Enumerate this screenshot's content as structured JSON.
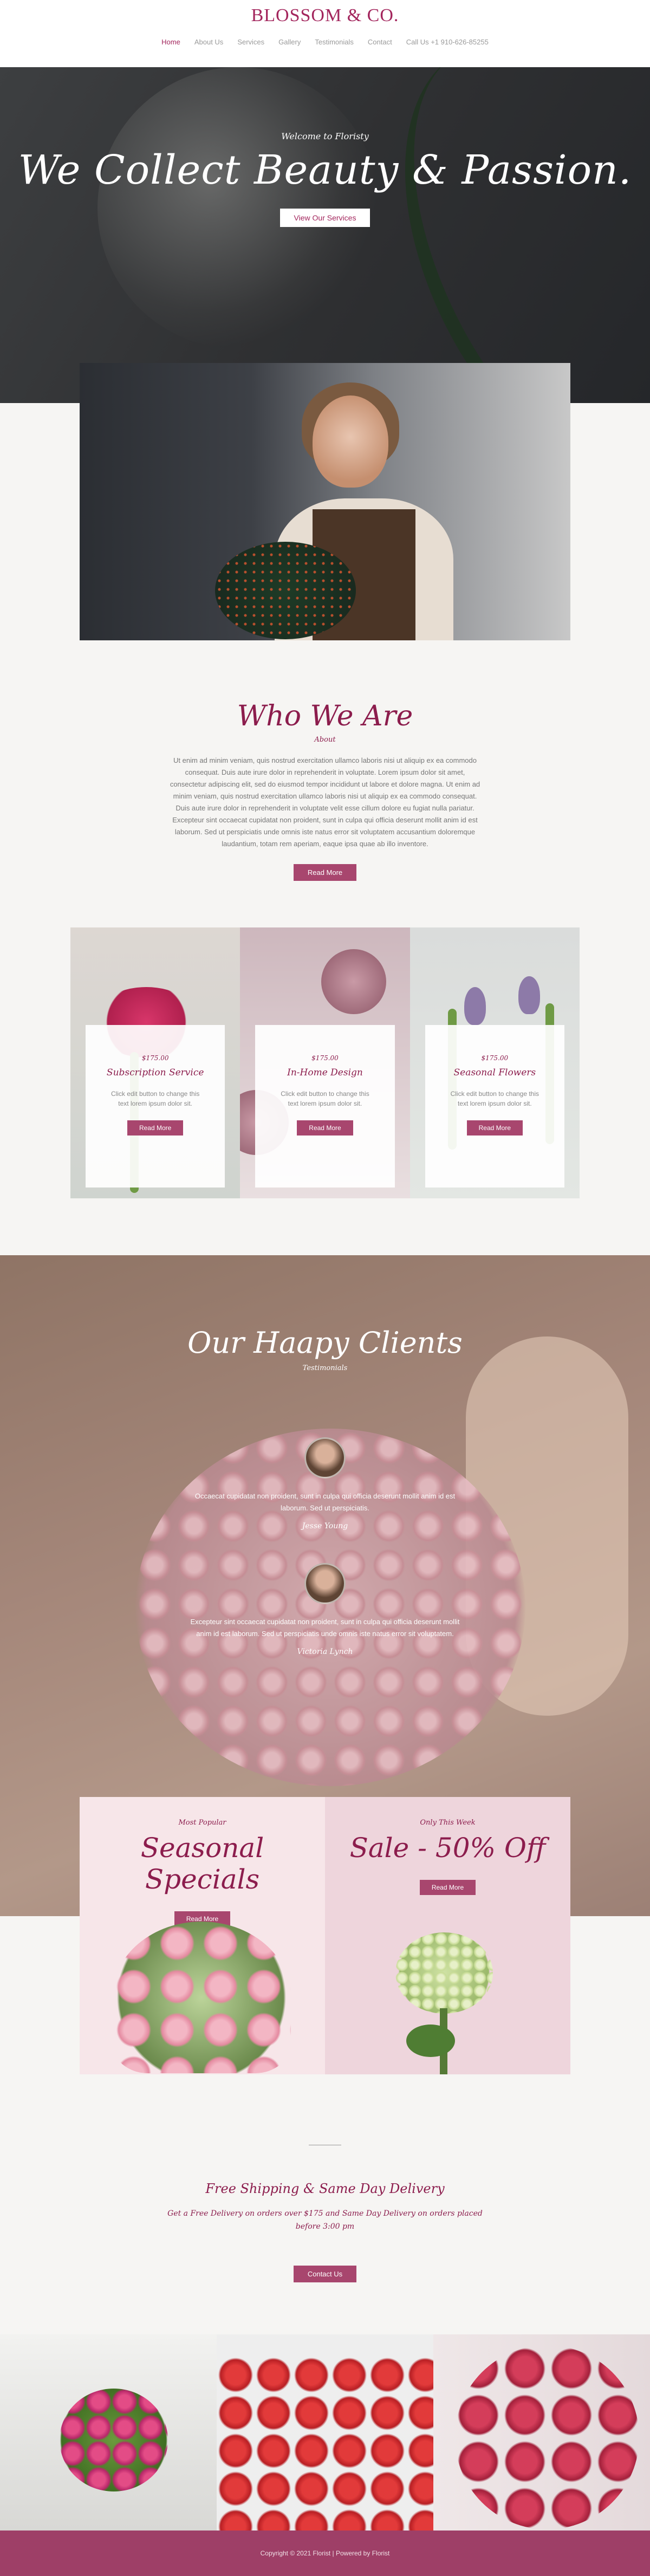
{
  "brand": {
    "logo": "BLOSSOM & CO."
  },
  "nav": {
    "items": [
      "Home",
      "About Us",
      "Services",
      "Gallery",
      "Testimonials",
      "Contact",
      "Call Us +1 910-626-85255"
    ]
  },
  "hero": {
    "eyebrow": "Welcome to Floristy",
    "title": "We Collect Beauty & Passion.",
    "button": "View Our Services"
  },
  "who": {
    "title": "Who We Are",
    "subtitle": "About",
    "body": "Ut enim ad minim veniam, quis nostrud exercitation ullamco laboris nisi ut aliquip ex ea commodo consequat. Duis aute irure dolor in reprehenderit in voluptate. Lorem ipsum dolor sit amet, consectetur adipiscing elit, sed do eiusmod tempor incididunt ut labore et dolore magna. Ut enim ad minim veniam, quis nostrud exercitation ullamco laboris nisi ut aliquip ex ea commodo consequat. Duis aute irure dolor in reprehenderit in voluptate velit esse cillum dolore eu fugiat nulla pariatur. Excepteur sint occaecat cupidatat non proident, sunt in culpa qui officia deserunt mollit anim id est laborum. Sed ut perspiciatis unde omnis iste natus error sit voluptatem accusantium doloremque laudantium, totam rem aperiam, eaque ipsa quae ab illo inventore.",
    "button": "Read More"
  },
  "services": [
    {
      "price": "$175.00",
      "title": "Subscription Service",
      "text": "Click edit button to change this text lorem ipsum dolor sit.",
      "button": "Read More"
    },
    {
      "price": "$175.00",
      "title": "In-Home Design",
      "text": "Click edit button to change this text lorem ipsum dolor sit.",
      "button": "Read More"
    },
    {
      "price": "$175.00",
      "title": "Seasonal Flowers",
      "text": "Click edit button to change this text lorem ipsum dolor sit.",
      "button": "Read More"
    }
  ],
  "clients": {
    "title": "Our Haapy Clients",
    "subtitle": "Testimonials",
    "testimonials": [
      {
        "quote": "Occaecat cupidatat non proident, sunt in culpa qui officia deserunt mollit anim id est laborum. Sed ut perspiciatis.",
        "author": "Jesse Young"
      },
      {
        "quote": "Excepteur sint occaecat cupidatat non proident, sunt in culpa qui officia deserunt mollit anim id est laborum. Sed ut perspiciatis unde omnis iste natus error sit voluptatem.",
        "author": "Victoria Lynch"
      }
    ]
  },
  "specials": [
    {
      "eyebrow": "Most Popular",
      "title": "Seasonal Specials",
      "button": "Read More"
    },
    {
      "eyebrow": "Only This Week",
      "title": "Sale - 50% Off",
      "button": "Read More"
    }
  ],
  "shipping": {
    "title": "Free Shipping & Same Day Delivery",
    "text": "Get a Free Delivery on orders over $175 and Same Day Delivery on orders placed before 3:00 pm",
    "button": "Contact Us"
  },
  "footer": {
    "text": "Copyright © 2021 Florist | Powered by Florist"
  },
  "colors": {
    "accent": "#a3265d",
    "button": "#a8466e",
    "footer": "#9e3f67"
  }
}
